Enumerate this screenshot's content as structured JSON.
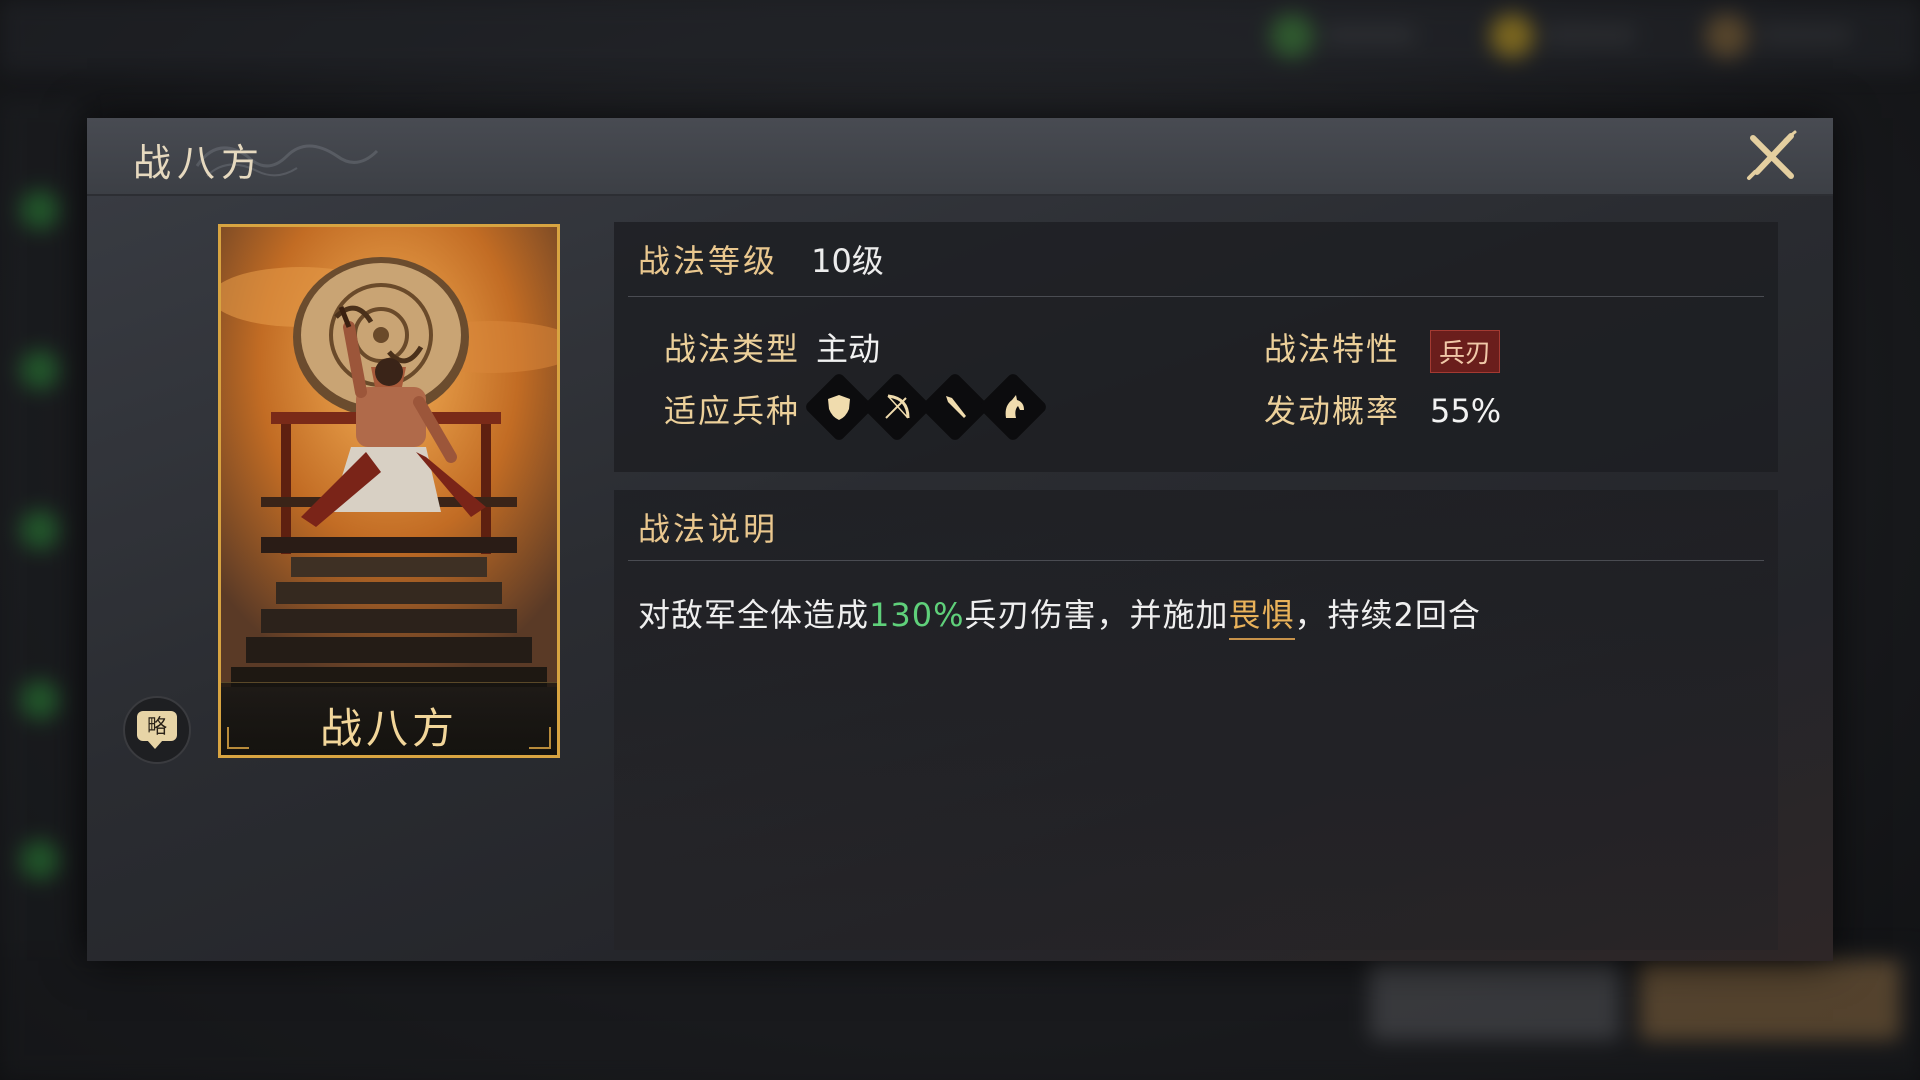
{
  "dialog": {
    "title": "战八方"
  },
  "card": {
    "name": "战八方"
  },
  "strategy_button": {
    "label": "略"
  },
  "info": {
    "level_label": "战法等级",
    "level_value": "10级",
    "type_label": "战法类型",
    "type_value": "主动",
    "trait_label": "战法特性",
    "trait_value": "兵刃",
    "troops_label": "适应兵种",
    "troop_icons": [
      "shield-icon",
      "bow-icon",
      "spear-icon",
      "horse-icon"
    ],
    "rate_label": "发动概率",
    "rate_value": "55%"
  },
  "description": {
    "title": "战法说明",
    "part1": "对敌军全体造成",
    "percent": "130%",
    "part2": "兵刃伤害，并施加",
    "effect": "畏惧",
    "part3": "，持续2回合"
  },
  "colors": {
    "gold": "#e9c78e",
    "green": "#5fd07a",
    "card_border": "#d8a441",
    "trait_bg": "#6a1e1c"
  }
}
